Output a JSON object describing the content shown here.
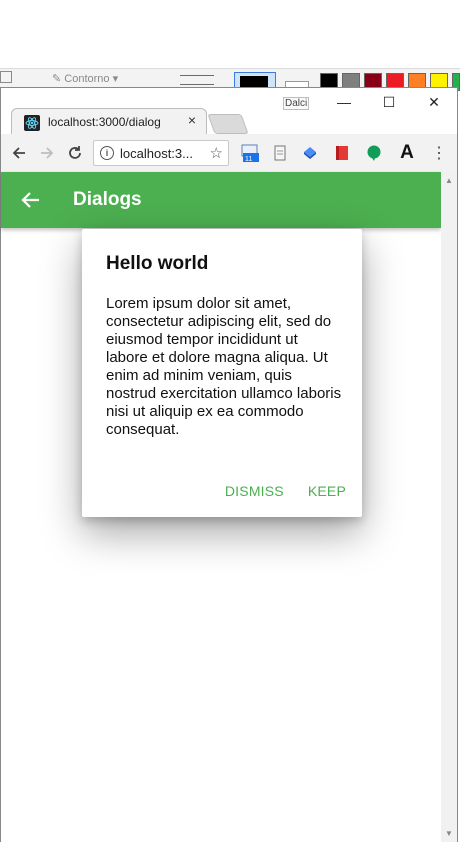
{
  "background_app": {
    "left_label": "Contorno",
    "swatches": [
      "#000000",
      "#7f7f7f",
      "#880015",
      "#ed1c24",
      "#ff7f27",
      "#fff200",
      "#22b14c"
    ]
  },
  "browser": {
    "user_label": "Dalci",
    "tab": {
      "title": "localhost:3000/dialog",
      "close": "×"
    },
    "address": {
      "url": "localhost:3...",
      "star": "☆"
    },
    "controls": {
      "minimize": "—",
      "maximize": "☐",
      "close": "✕"
    },
    "extension_badge": "11",
    "font_icon": "A"
  },
  "app": {
    "title": "Dialogs",
    "accent_color": "#4caf50"
  },
  "dialog": {
    "title": "Hello world",
    "body": "Lorem ipsum dolor sit amet, consectetur adipiscing elit, sed do eiusmod tempor incididunt ut labore et dolore magna aliqua. Ut enim ad minim veniam, quis nostrud exercitation ullamco laboris nisi ut aliquip ex ea commodo consequat.",
    "dismiss_label": "DISMISS",
    "keep_label": "KEEP"
  }
}
